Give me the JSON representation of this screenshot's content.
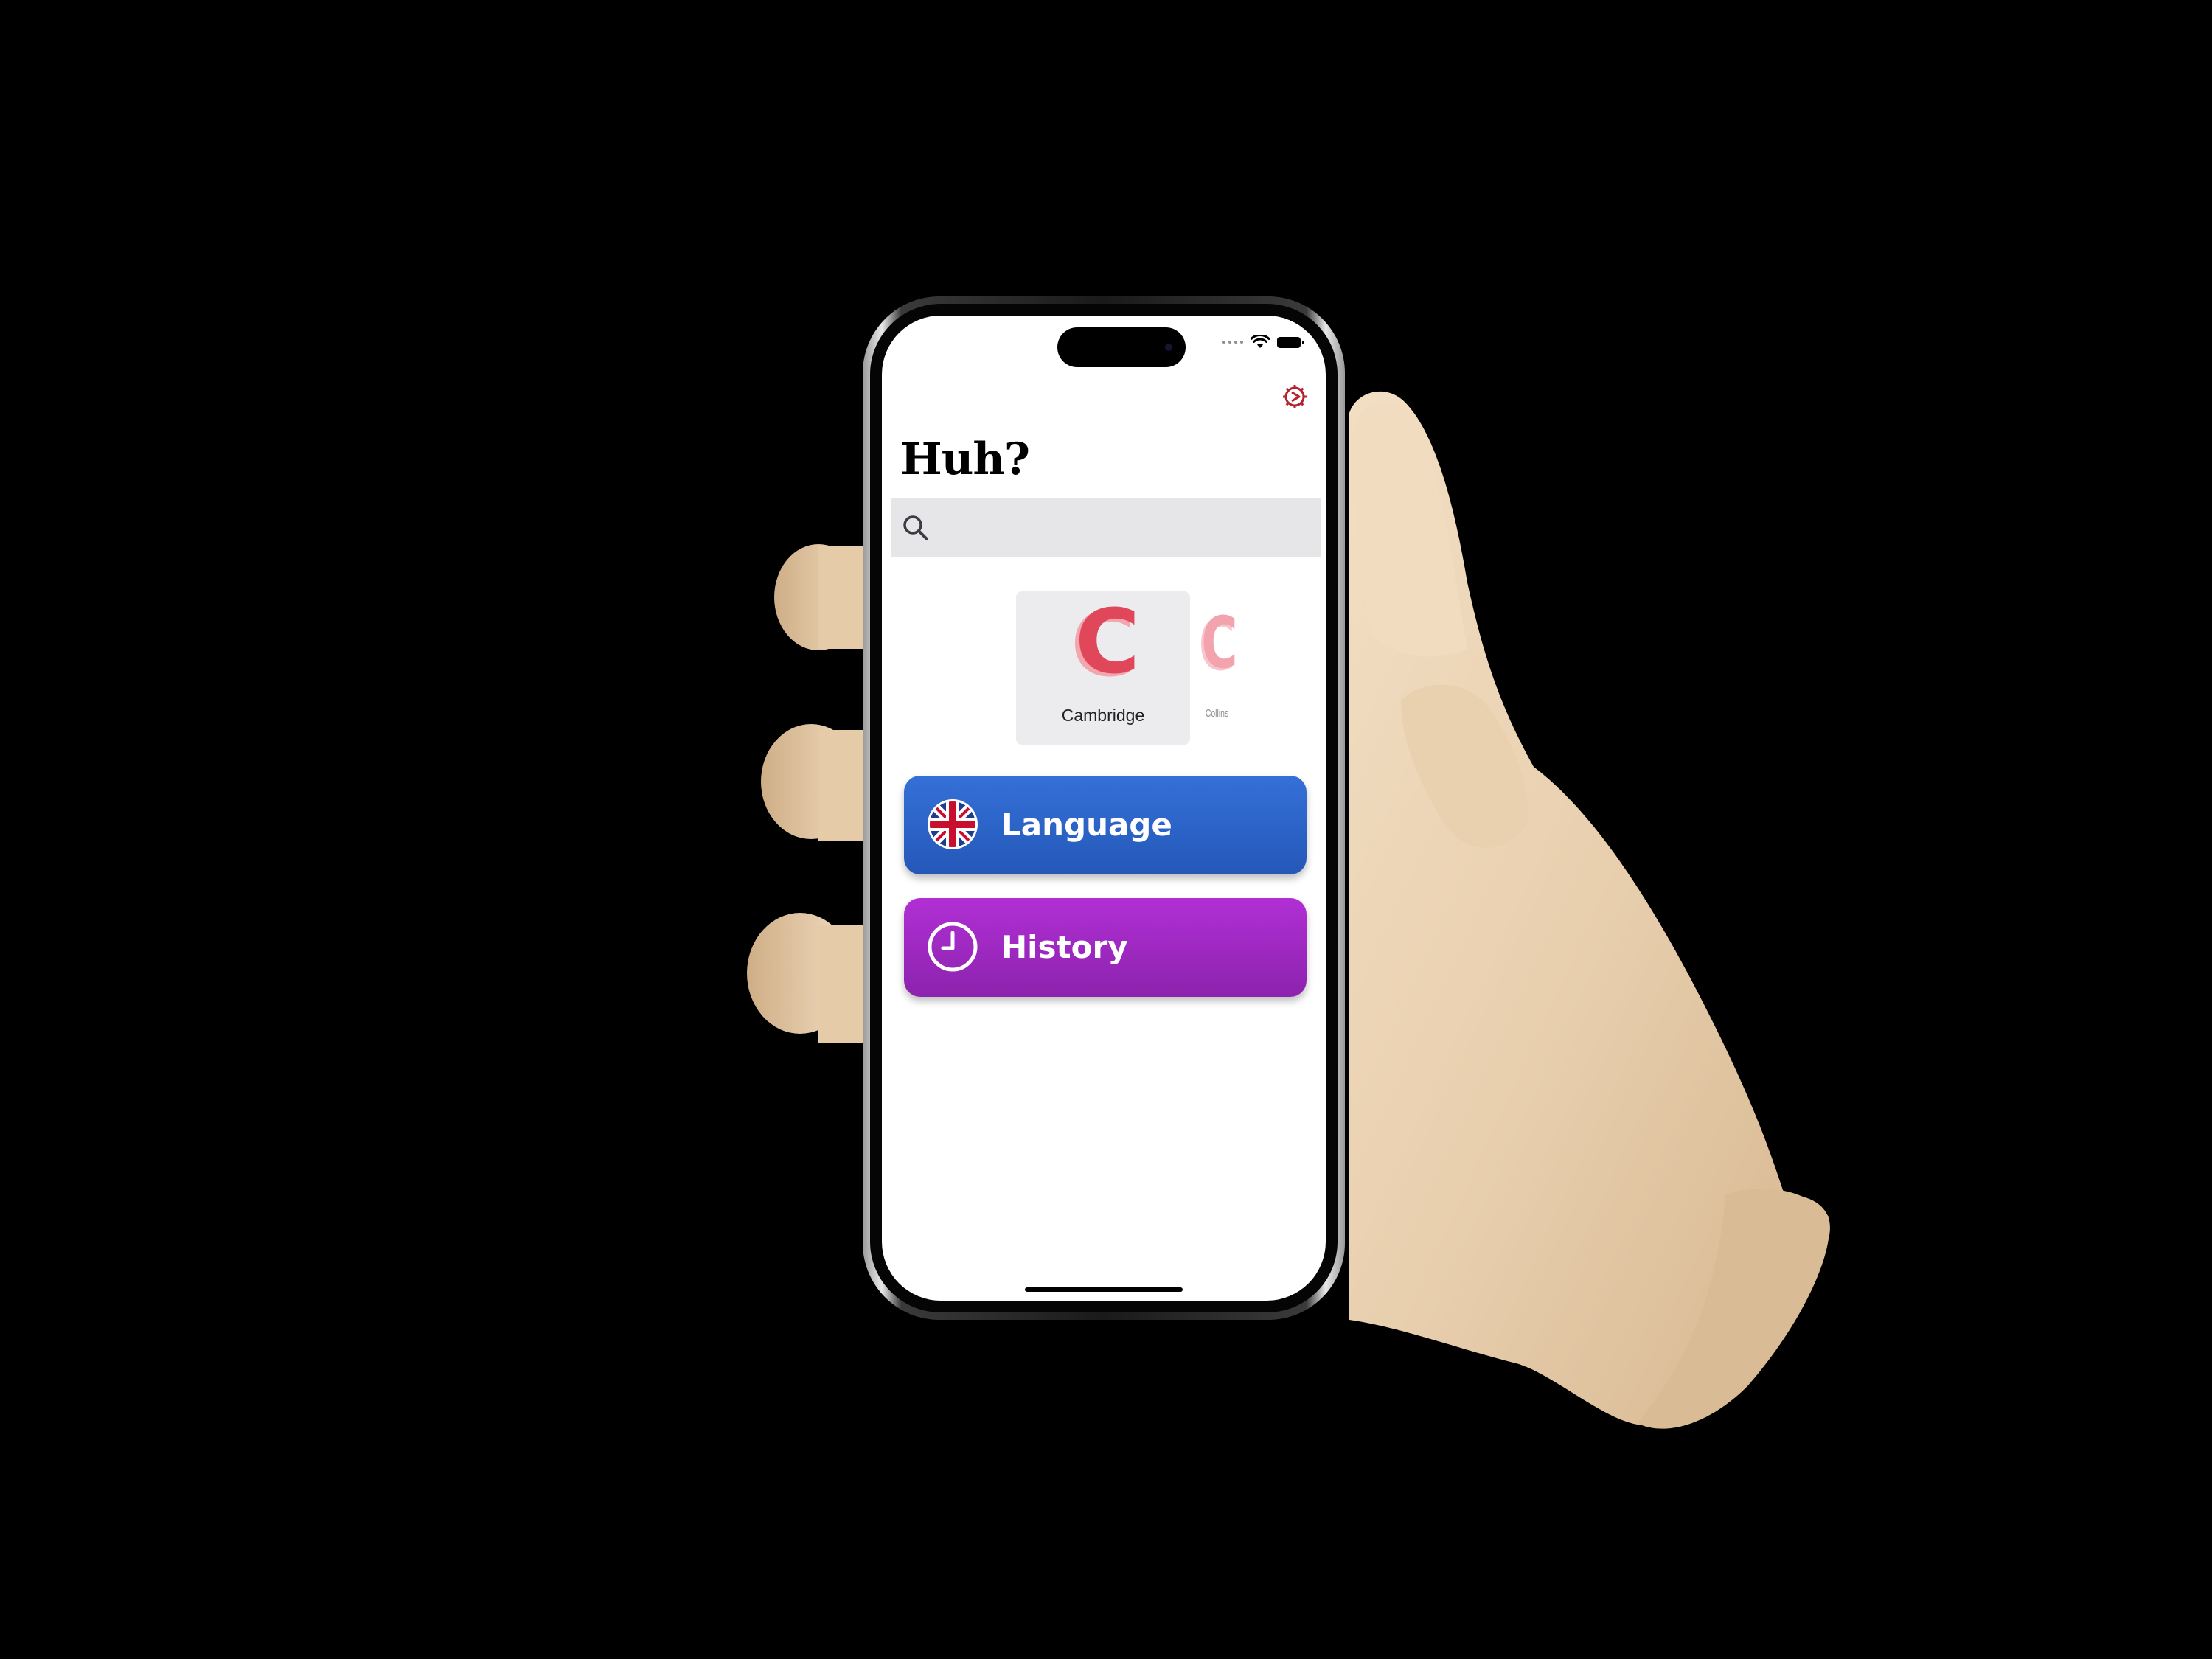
{
  "app": {
    "title": "Huh?"
  },
  "search": {
    "placeholder": ""
  },
  "dictionaries": [
    {
      "label": "Cambridge",
      "selected": true,
      "logo_letter": "C",
      "color": "#e0475a"
    },
    {
      "label": "Collins",
      "selected": false,
      "logo_letter": "C",
      "color": "#f3a3ae"
    }
  ],
  "buttons": {
    "language_label": "Language",
    "history_label": "History"
  },
  "colors": {
    "language_button": "#2f66cc",
    "history_button": "#a22bc6",
    "settings_icon": "#b3242f",
    "search_bar": "#e6e6e8"
  },
  "icons": {
    "settings": "gear-icon",
    "search": "search-icon",
    "language": "uk-flag-icon",
    "history": "clock-icon"
  }
}
